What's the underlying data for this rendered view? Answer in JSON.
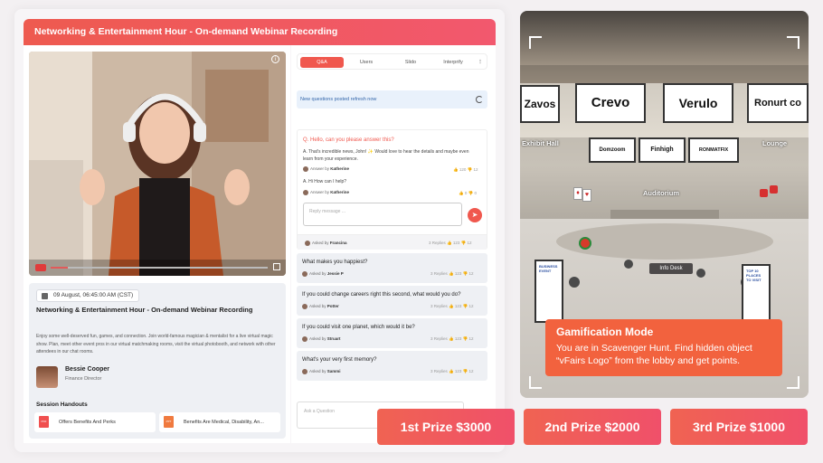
{
  "webinar": {
    "title": "Networking & Entertainment Hour - On-demand Webinar Recording",
    "session_date": "09 August, 06:45:00 AM (CST)",
    "session_title": "Networking & Entertainment Hour - On-demand Webinar Recording",
    "description": "Enjoy some well-deserved fun, games, and connection. Join world-famous magician & mentalist for a live virtual magic show. Plan, meet other event pros in our virtual matchmaking rooms, visit the virtual photobooth, and network with other attendees in our chat rooms.",
    "speaker": {
      "name": "Bessie Cooper",
      "role": "Finance Director"
    },
    "handouts_label": "Session Handouts",
    "handouts": [
      {
        "icon": "pdf",
        "label": "Offers Benefits And Perks"
      },
      {
        "icon": "ppt",
        "label": "Benefits Are Medical, Disability, An..."
      }
    ],
    "video_progress": 0.08
  },
  "qa": {
    "tabs": [
      "Q&A",
      "Users",
      "Slido",
      "Interprify"
    ],
    "active_tab": "Q&A",
    "refresh_notice": "New questions posted refresh now",
    "thread": {
      "question": "Q. Hello, can you please answer this?",
      "answer1": "A. That's incredible news, John! ✨ Would love to hear the details and maybe even learn from your experience.",
      "answer1_by_label": "Answer by",
      "answer1_by": "Katherine",
      "answer1_likes": "120",
      "answer1_dislikes": "12",
      "answer2": "A. Hi How can I help?",
      "answer2_by_label": "Answer by",
      "answer2_by": "Katherine",
      "answer2_likes": "0",
      "answer2_dislikes": "0",
      "reply_placeholder": "Reply message ...",
      "asked_label": "Asked by",
      "asked_by": "Francina",
      "replies": "3 Replies",
      "likes": "123",
      "dislikes": "12"
    },
    "questions": [
      {
        "text": "What makes you happiest?",
        "asked_label": "Asked by",
        "asked_by": "Jessie P",
        "replies": "3 Replies",
        "likes": "123",
        "dislikes": "12"
      },
      {
        "text": "If you could change careers right this second, what would you do?",
        "asked_label": "Asked by",
        "asked_by": "Potter",
        "replies": "3 Replies",
        "likes": "123",
        "dislikes": "12"
      },
      {
        "text": "If you could visit one planet, which would it be?",
        "asked_label": "Asked by",
        "asked_by": "Struart",
        "replies": "3 Replies",
        "likes": "123",
        "dislikes": "12"
      },
      {
        "text": "What's your very first memory?",
        "asked_label": "Asked by",
        "asked_by": "Sammi",
        "replies": "3 Replies",
        "likes": "123",
        "dislikes": "12"
      }
    ],
    "ask_placeholder": "Ask a Question"
  },
  "venue": {
    "sponsors_top": [
      "Zavos",
      "Crevo",
      "Verulo",
      "Ronurt co"
    ],
    "sponsors_small": [
      "Domzoom",
      "Finhigh",
      "RONMATFIX"
    ],
    "labels": {
      "exhibit_hall": "Exhibit Hall",
      "lounge": "Lounge",
      "auditorium": "Auditorium",
      "info_desk": "Info Desk"
    },
    "standee_text": "BUSINESS EVENT",
    "standee_right": "TOP 10 PLACES TO VISIT",
    "gamification": {
      "title": "Gamification Mode",
      "text": "You are in Scavenger Hunt. Find hidden object “vFairs Logo” from the lobby and get points."
    }
  },
  "prizes": [
    {
      "label": "1st Prize  $3000"
    },
    {
      "label": "2nd Prize  $2000"
    },
    {
      "label": "3rd Prize  $1000"
    }
  ],
  "colors": {
    "accent": "#f0584e",
    "gamification": "#f2623e"
  }
}
